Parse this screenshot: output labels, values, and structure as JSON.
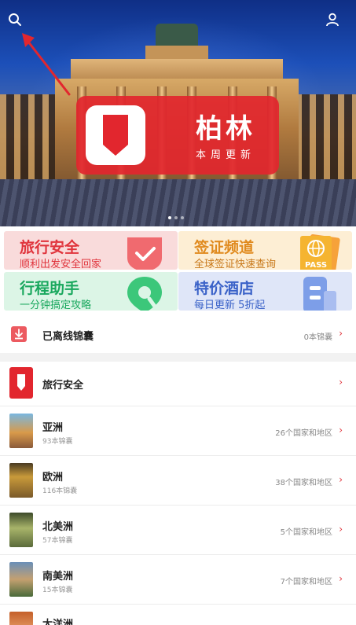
{
  "hero": {
    "city_name": "柏林",
    "city_sub": "本周更新",
    "carousel_dots": 3,
    "active_dot": 0
  },
  "icons": {
    "search": "search-icon",
    "profile": "user-icon"
  },
  "services": [
    {
      "title": "旅行安全",
      "sub": "顺利出发安全回家",
      "title_color": "#e0343c",
      "sub_color": "#e0343c",
      "bg": "#f9dbdb"
    },
    {
      "title": "签证频道",
      "sub": "全球签证快速查询",
      "title_color": "#e08a1e",
      "sub_color": "#c8781a",
      "bg": "#fdeed4"
    },
    {
      "title": "行程助手",
      "sub": "一分钟搞定攻略",
      "title_color": "#1aa85e",
      "sub_color": "#1aa85e",
      "bg": "#dcf5e6"
    },
    {
      "title": "特价酒店",
      "sub": "每日更新 5折起",
      "title_color": "#3a62c8",
      "sub_color": "#3a62c8",
      "bg": "#dfe6f8"
    }
  ],
  "visa_badge": "PASS",
  "offline": {
    "label": "已离线锦囊",
    "meta": "0本锦囊"
  },
  "safety": {
    "label": "旅行安全"
  },
  "continents": [
    {
      "name": "亚洲",
      "count": "93本锦囊",
      "meta": "26个国家和地区"
    },
    {
      "name": "欧洲",
      "count": "116本锦囊",
      "meta": "38个国家和地区"
    },
    {
      "name": "北美洲",
      "count": "57本锦囊",
      "meta": "5个国家和地区"
    },
    {
      "name": "南美洲",
      "count": "15本锦囊",
      "meta": "7个国家和地区"
    },
    {
      "name": "大洋洲",
      "count": "",
      "meta": ""
    }
  ],
  "colors": {
    "brand_red": "#e2262e",
    "chevron": "#e0343c"
  }
}
